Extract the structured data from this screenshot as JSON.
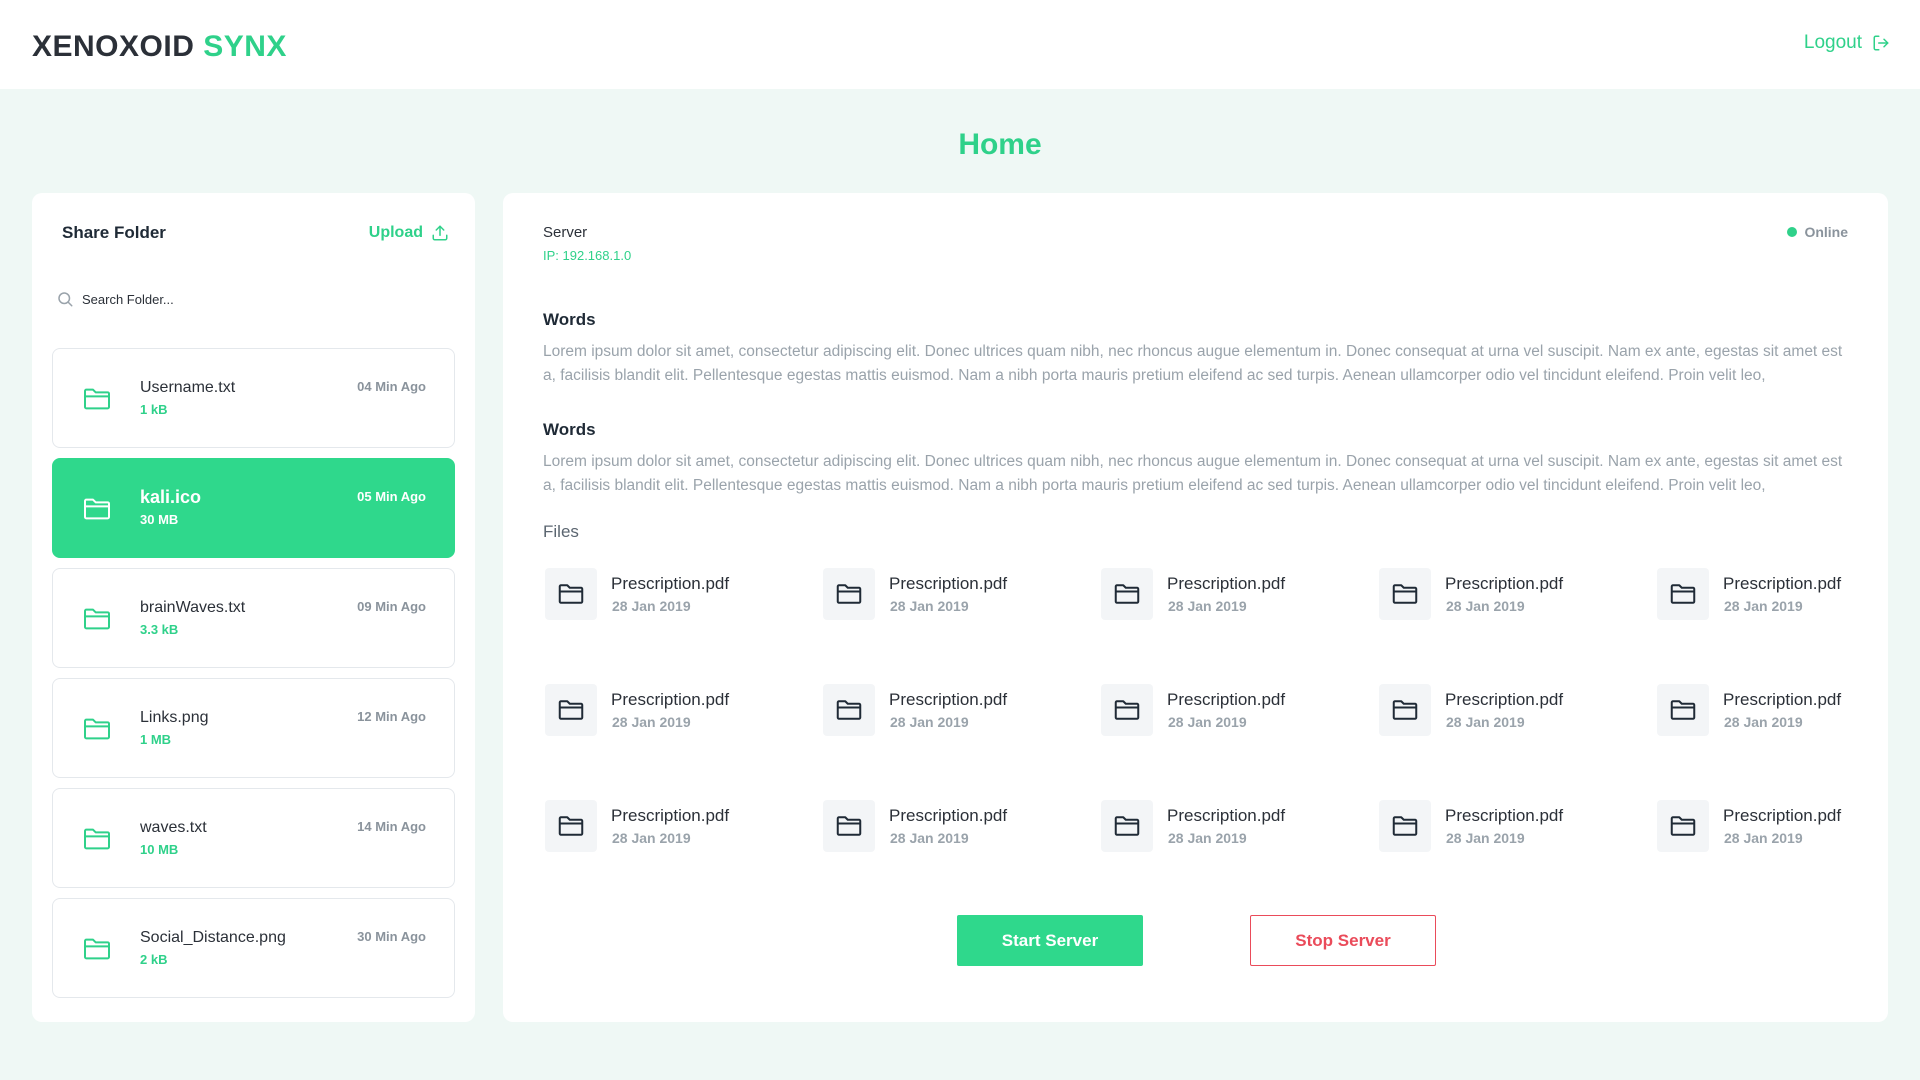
{
  "colors": {
    "accent": "#2fd18a",
    "danger": "#ea4b5a",
    "background": "#eff8f5"
  },
  "header": {
    "brand_primary": "XENOXOID",
    "brand_accent": "SYNX",
    "logout_label": "Logout",
    "logout_icon": "logout-icon"
  },
  "page": {
    "title": "Home"
  },
  "share_folder": {
    "title": "Share Folder",
    "upload_label": "Upload",
    "search_placeholder": "Search Folder...",
    "items": [
      {
        "name": "Username.txt",
        "size": "1 kB",
        "time": "04 Min Ago",
        "active": false
      },
      {
        "name": "kali.ico",
        "size": "30 MB",
        "time": "05 Min Ago",
        "active": true
      },
      {
        "name": "brainWaves.txt",
        "size": "3.3 kB",
        "time": "09 Min Ago",
        "active": false
      },
      {
        "name": "Links.png",
        "size": "1 MB",
        "time": "12 Min Ago",
        "active": false
      },
      {
        "name": "waves.txt",
        "size": "10 MB",
        "time": "14 Min Ago",
        "active": false
      },
      {
        "name": "Social_Distance.png",
        "size": "2 kB",
        "time": "30 Min Ago",
        "active": false
      }
    ]
  },
  "server": {
    "label": "Server",
    "ip": "IP: 192.168.1.0",
    "status": "Online"
  },
  "words": [
    {
      "heading": "Words",
      "text": "Lorem ipsum dolor sit amet, consectetur adipiscing elit. Donec ultrices quam nibh, nec rhoncus augue elementum in. Donec consequat at urna vel suscipit. Nam ex ante, egestas sit amet est a, facilisis blandit elit. Pellentesque egestas mattis euismod. Nam a nibh porta mauris pretium eleifend ac sed turpis. Aenean ullamcorper odio vel tincidunt eleifend. Proin velit leo,"
    },
    {
      "heading": "Words",
      "text": "Lorem ipsum dolor sit amet, consectetur adipiscing elit. Donec ultrices quam nibh, nec rhoncus augue elementum in. Donec consequat at urna vel suscipit. Nam ex ante, egestas sit amet est a, facilisis blandit elit. Pellentesque egestas mattis euismod. Nam a nibh porta mauris pretium eleifend ac sed turpis. Aenean ullamcorper odio vel tincidunt eleifend. Proin velit leo,"
    }
  ],
  "files": {
    "heading": "Files",
    "items": [
      {
        "name": "Prescription.pdf",
        "date": "28 Jan 2019"
      },
      {
        "name": "Prescription.pdf",
        "date": "28 Jan 2019"
      },
      {
        "name": "Prescription.pdf",
        "date": "28 Jan 2019"
      },
      {
        "name": "Prescription.pdf",
        "date": "28 Jan 2019"
      },
      {
        "name": "Prescription.pdf",
        "date": "28 Jan 2019"
      },
      {
        "name": "Prescription.pdf",
        "date": "28 Jan 2019"
      },
      {
        "name": "Prescription.pdf",
        "date": "28 Jan 2019"
      },
      {
        "name": "Prescription.pdf",
        "date": "28 Jan 2019"
      },
      {
        "name": "Prescription.pdf",
        "date": "28 Jan 2019"
      },
      {
        "name": "Prescription.pdf",
        "date": "28 Jan 2019"
      },
      {
        "name": "Prescription.pdf",
        "date": "28 Jan 2019"
      },
      {
        "name": "Prescription.pdf",
        "date": "28 Jan 2019"
      },
      {
        "name": "Prescription.pdf",
        "date": "28 Jan 2019"
      },
      {
        "name": "Prescription.pdf",
        "date": "28 Jan 2019"
      },
      {
        "name": "Prescription.pdf",
        "date": "28 Jan 2019"
      }
    ]
  },
  "actions": {
    "start_label": "Start Server",
    "stop_label": "Stop Server"
  }
}
